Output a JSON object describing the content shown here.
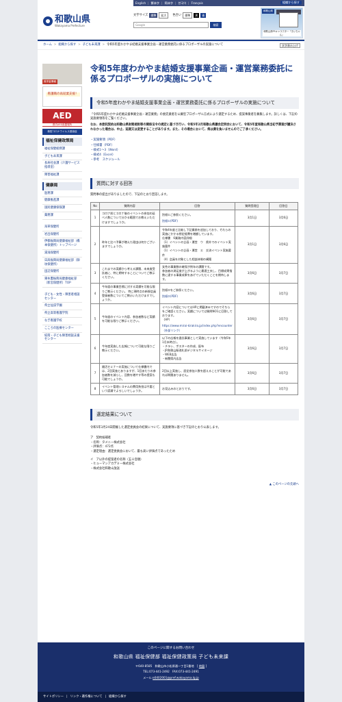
{
  "header": {
    "site_name": "和歌山県",
    "site_name_en": "Wakayama Prefecture",
    "top_links": [
      "English",
      "繁体字",
      "简体字",
      "한국어",
      "Français"
    ],
    "contact_button": "組織から探す",
    "font_size_label": "文字サイズ",
    "font_standard": "標準",
    "font_large": "拡大",
    "color_label": "色合い",
    "color_standard": "標準",
    "color_black": "黒",
    "color_blue": "青",
    "search_placeholder": "Google",
    "search_button": "検索",
    "mascot_tag": "和歌山県",
    "mascot_caption": "和歌山県PRキャラクター「きいちゃん」"
  },
  "breadcrumb": {
    "items": [
      "ホーム",
      "組織から探す",
      "子ども未来課"
    ],
    "current": "令和5年度わかやま結婚支援事業企画・運営業務委託に係るプロポーザルの実施について",
    "print_button": "文字表示上げ"
  },
  "sidebar": {
    "banners": {
      "b1_caption": "奨学金情報",
      "b2_text": "看護職の再就業支援！",
      "b3_text": "AED",
      "b3_sub": "県内AED設置場所",
      "b4_text": "新型コロナウイルス感染症"
    },
    "section1_title": "福祉保健政策局",
    "section1_items": [
      "福祉保健総務課",
      "子ども未来課",
      "長寿社会課（介護サービス指導室）",
      "障害福祉課"
    ],
    "section2_title": "健康局",
    "section2_items": [
      "医務課",
      "健康推進課",
      "国民健康保険課",
      "薬務課"
    ],
    "section3_items": [
      "海草保健所",
      "岩出保健所",
      "伊都振興局健康福祉部（橋本保健所）トップページ",
      "湯浅保健所",
      "日高振興局健康福祉部（御坊保健所）",
      "田辺保健所",
      "東牟婁振興局健康福祉部（新宮保健所）TOP"
    ],
    "section4_items": [
      "子ども・女性・障害者相談センター",
      "県立仙渓学園",
      "県立高等看護学院",
      "なぎ看護学校",
      "こころの医療センター",
      "紀南・子ども障害相談支援センター"
    ]
  },
  "main": {
    "title": "令和5年度わかやま結婚支援事業企画・運営業務委託に係るプロポーザルの実施について",
    "section1_title": "令和5年度わかやま結婚支援事業企画・運営業務委託に係るプロポーザルの実施について",
    "intro": "「令和5年度わかやま結婚支援事業企画・運営業務」の委託業者を公募型プロポーザル方式により選定するため、提案事業者を募集します。詳しくは、下記の実施要領等をご覧ください。",
    "notice": "なお、本委託契約は和歌山県財務規則等の関係法令の規定に基づき行い、令和5年2月和歌山県議会定例会において、令和5年度和歌山県当初予算案が議決されなかった場合は、中止、延期又は変更することがあります。また、その場合において、県は費を負いませんのでご了承ください。",
    "links": [
      "・実施要領（PDF）",
      "・仕様書（PDF）",
      "・様式1～3（Word）",
      "・様式4（Excel）",
      "・参考　スケジュール"
    ],
    "section2_title": "質問に対する回答",
    "qa_intro": "質問事の提出がありましたので、下記のとおり回答します。",
    "table_headers": [
      "No",
      "質問内容",
      "回答",
      "質問受理日",
      "回答日"
    ],
    "qa_rows": [
      {
        "no": "1",
        "q": "コロナ前とコロナ後のイベントの参加の延べ人数について分かる範囲でお教えいただけますでしょうか。",
        "a1": "別紙①ご参照ください。",
        "a2": "別紙①(PDF)",
        "recv": "3月1日",
        "ans": "3月6日"
      },
      {
        "no": "2",
        "q": "昨年と比べ予算が増えた理由は何かございますでしょうか。",
        "a1": "令和4年度と比較し下記業務を追加しており、それらの実施にかかる想定経費を増額しています。\n仕様書　6業務内容詳細\n（1）イベントの企画・運営　ウ　県外でのイベント実施要件\n（1）イベントの企画・運営　エ　交流イベント実施要件\n（4）会員を対象とした相談体制の構築",
        "a2": "",
        "recv": "3月1日",
        "ans": "3月6日"
      },
      {
        "no": "3",
        "q": "これまでの実績から考える課題、未来度受託者に、特に期待することについてご教示ください。",
        "a1": "女性の事業数の確保が例年の課題です。\n参加者の満足度が上がるように最適工夫し、目標成果指数に達する事業成果をあげていただくことを期待します。",
        "a2": "",
        "recv": "3月6日",
        "ans": "3月7日"
      },
      {
        "no": "4",
        "q": "今年度の事業目標に対する実績を可能な限りご教示ください。\n特に現時点の新規会員登録者数についてご教示いただけますでしょうか。",
        "a1": "別紙②をご参照ください。",
        "a2": "別紙②(PDF)",
        "recv": "3月6日",
        "ans": "3月7日"
      },
      {
        "no": "5",
        "q": "今年度のイベント内容、参加者数など実績を可能な限りご教示ください。",
        "a1": "イベント内容についてはHPに掲載済みですのでそちらをご確認ください。実績については質問NO1に回答しております。\n（HP）",
        "a2": "https://www.mirai-kirakira.jp/index.php?encounter（外部リンク）",
        "recv": "3月6日",
        "ans": "3月7日"
      },
      {
        "no": "6",
        "q": "今年度実施した広報について可能な限りご教示ください。",
        "a1": "以下の広報を委託事業として実施しています（令和5年1月末時点）。\n・チラシ、ポスターの作成、配布\n・JR和歌山駅改札前デジタルサイネージ\n・WEB広告\n・新聞県内広告",
        "a2": "",
        "recv": "3月6日",
        "ans": "3月7日"
      },
      {
        "no": "7",
        "q": "婚活セミナーの実施について仕様書内では、2回実施とありますが、1回あたりの参加者数を減らし、回数を増やす等の提案も可能でしょうか。",
        "a1": "2回以上実施し、設定参加人数を超えることが可能であれば問題ありません。",
        "a2": "",
        "recv": "3月6日",
        "ans": "3月7日"
      },
      {
        "no": "8",
        "q": "イベント管理システムの費用負担は不要という認識でよろしいでしょうか。",
        "a1": "お見込みのとおりです。",
        "a2": "",
        "recv": "3月6日",
        "ans": "3月7日"
      }
    ],
    "section3_title": "選定結果について",
    "result_intro": "令和5年3月24日開催した選定委員会の結果について、実施要項に基づき下記のとおり公表します。",
    "result_lines": [
      "ア　契約候補者",
      "・名称：タメニー株式会社",
      "・評価点：472点",
      "・選定理由：選定委員会において、最も高い評価点であったため",
      "",
      "イ　ア以外の提案者の名称（五十音順）",
      "・ヒューマンアカデミー株式会社",
      "・株式会社和歌山放送"
    ],
    "to_top": "このページの先頭へ"
  },
  "footer": {
    "ask": "このページに関するお問い合わせ",
    "dept": "和歌山県 福祉保健部 福祉保健政策局 子ども未来課",
    "addr": "〒640-8585　和歌山市小松原通一丁目1番地",
    "map": "地図",
    "tel": "TEL:073-441-2492　FAX:073-441-2491",
    "mail_label": "メール:",
    "mail": "e0402001@pref.wakayama.lg.jp",
    "bottom_links": [
      "サイトポリシー",
      "リンク・著作権について",
      "組織から探す"
    ]
  }
}
